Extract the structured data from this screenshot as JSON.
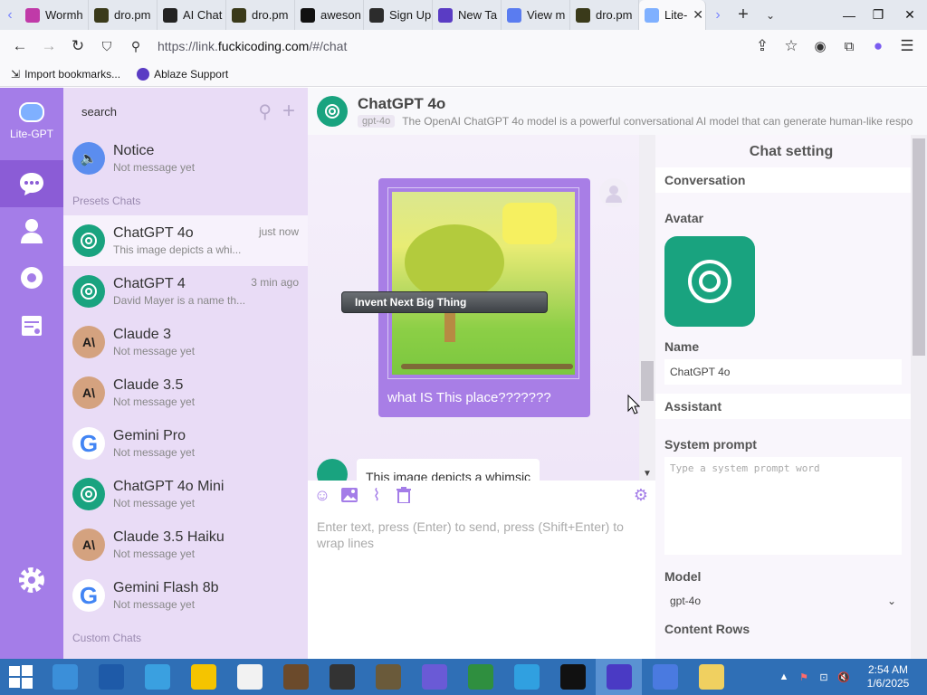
{
  "browser": {
    "tabs": [
      {
        "label": "Wormh",
        "icon": "wormhole-icon",
        "color": "#c03aa8"
      },
      {
        "label": "dro.pm",
        "icon": "terminal-icon",
        "color": "#3a3a1a"
      },
      {
        "label": "AI Chat",
        "icon": "ai-chat-icon",
        "color": "#222222"
      },
      {
        "label": "dro.pm",
        "icon": "terminal-icon",
        "color": "#3a3a1a"
      },
      {
        "label": "aweson",
        "icon": "github-icon",
        "color": "#111111"
      },
      {
        "label": "Sign Up",
        "icon": "signup-icon",
        "color": "#2c2c2c"
      },
      {
        "label": "New Ta",
        "icon": "ablaze-icon",
        "color": "#5a3cc4"
      },
      {
        "label": "View m",
        "icon": "view-icon",
        "color": "#5a7cf0"
      },
      {
        "label": "dro.pm",
        "icon": "terminal-icon",
        "color": "#3a3a1a"
      },
      {
        "label": "Lite-",
        "icon": "lite-gpt-icon",
        "color": "#7fb0ff"
      }
    ],
    "url_prefix": "https://link.",
    "url_host": "fuckicoding.com",
    "url_path": "/#/chat",
    "bookmarks": [
      {
        "label": "Import bookmarks...",
        "icon": "import-icon"
      },
      {
        "label": "Ablaze Support",
        "icon": "ablaze-icon"
      }
    ]
  },
  "rail": {
    "logo_label": "Lite-GPT",
    "accent": "#a47de8"
  },
  "sidebar": {
    "search_placeholder": "search",
    "notice": {
      "name": "Notice",
      "sub": "Not message yet"
    },
    "presets_label": "Presets Chats",
    "custom_label": "Custom Chats",
    "chats": [
      {
        "name": "ChatGPT 4o",
        "sub": "This image depicts a whi...",
        "time": "just now",
        "avatar": "openai-icon",
        "color": "#19a37f",
        "active": true
      },
      {
        "name": "ChatGPT 4",
        "sub": "David Mayer is a name th...",
        "time": "3 min ago",
        "avatar": "openai-icon",
        "color": "#19a37f"
      },
      {
        "name": "Claude 3",
        "sub": "Not message yet",
        "time": "",
        "avatar": "anthropic-icon",
        "color": "#d4a27f"
      },
      {
        "name": "Claude 3.5",
        "sub": "Not message yet",
        "time": "",
        "avatar": "anthropic-icon",
        "color": "#d4a27f"
      },
      {
        "name": "Gemini Pro",
        "sub": "Not message yet",
        "time": "",
        "avatar": "google-icon",
        "color": "#ffffff"
      },
      {
        "name": "ChatGPT 4o Mini",
        "sub": "Not message yet",
        "time": "",
        "avatar": "openai-icon",
        "color": "#19a37f"
      },
      {
        "name": "Claude 3.5 Haiku",
        "sub": "Not message yet",
        "time": "",
        "avatar": "anthropic-icon",
        "color": "#d4a27f"
      },
      {
        "name": "Gemini Flash 8b",
        "sub": "Not message yet",
        "time": "",
        "avatar": "google-icon",
        "color": "#ffffff"
      }
    ]
  },
  "chat": {
    "title": "ChatGPT 4o",
    "model_tag": "gpt-4o",
    "description": "The OpenAI ChatGPT 4o model is a powerful conversational AI model that can generate human-like respo",
    "user_message": "what IS This place???????",
    "bot_message_preview": "This image depicts a whimsic",
    "overlay_badge": "Invent Next Big Thing",
    "input_placeholder": "Enter text, press (Enter) to send, press (Shift+Enter) to wrap lines"
  },
  "settings": {
    "title": "Chat setting",
    "conversation_label": "Conversation",
    "avatar_label": "Avatar",
    "name_label": "Name",
    "name_value": "ChatGPT 4o",
    "assistant_label": "Assistant",
    "system_prompt_label": "System prompt",
    "system_prompt_placeholder": "Type a system prompt word",
    "model_label": "Model",
    "model_value": "gpt-4o",
    "content_rows_label": "Content Rows"
  },
  "taskbar": {
    "time": "2:54 AM",
    "date": "1/6/2025"
  }
}
